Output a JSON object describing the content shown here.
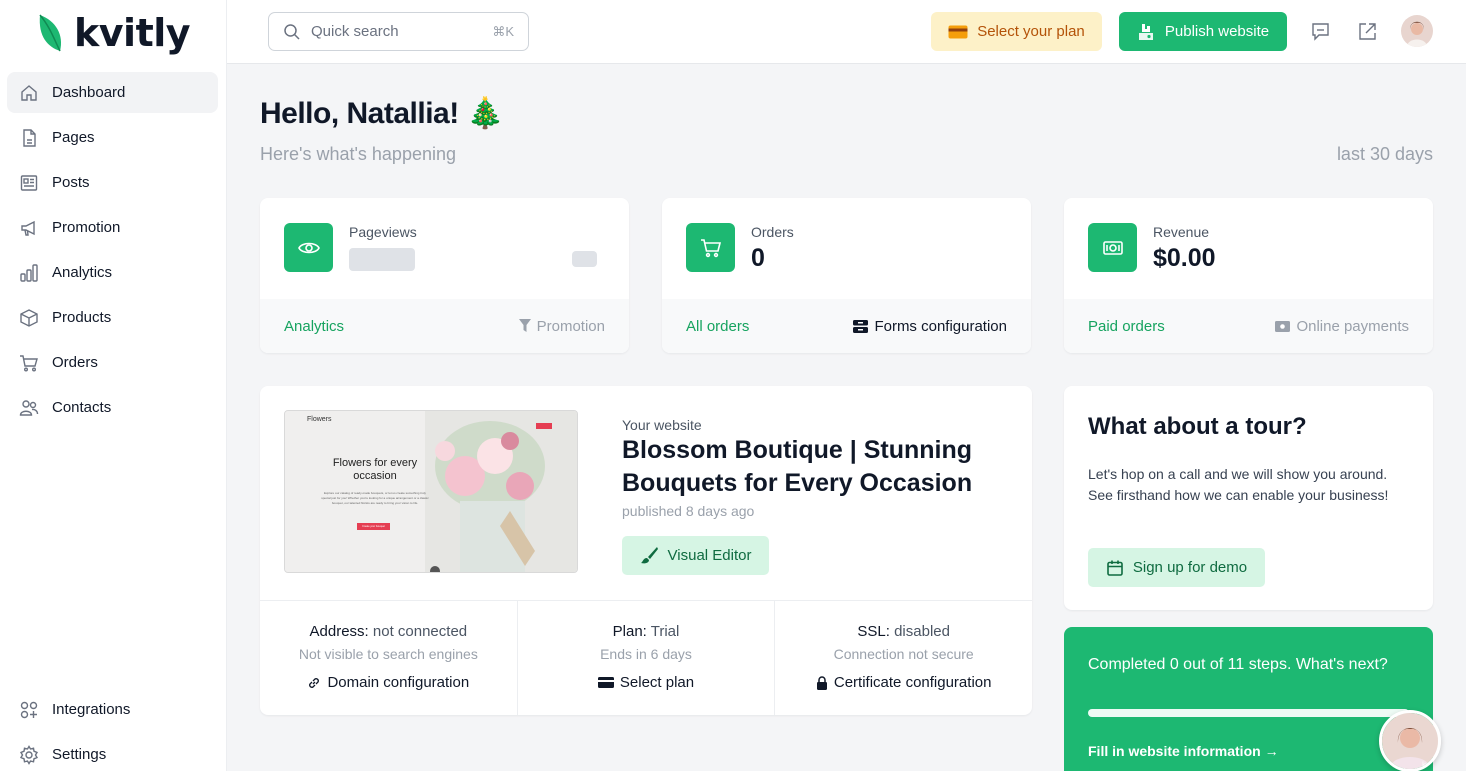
{
  "brand": {
    "name": "kvitly"
  },
  "sidebar": {
    "items": [
      {
        "label": "Dashboard",
        "icon": "home-icon",
        "active": true
      },
      {
        "label": "Pages",
        "icon": "page-icon"
      },
      {
        "label": "Posts",
        "icon": "posts-icon"
      },
      {
        "label": "Promotion",
        "icon": "megaphone-icon"
      },
      {
        "label": "Analytics",
        "icon": "bar-chart-icon"
      },
      {
        "label": "Products",
        "icon": "box-icon"
      },
      {
        "label": "Orders",
        "icon": "cart-icon"
      },
      {
        "label": "Contacts",
        "icon": "users-icon"
      }
    ],
    "bottom_items": [
      {
        "label": "Integrations",
        "icon": "integrations-icon"
      },
      {
        "label": "Settings",
        "icon": "gear-icon"
      }
    ]
  },
  "topbar": {
    "search_placeholder": "Quick search",
    "search_shortcut": "⌘K",
    "select_plan_label": "Select your plan",
    "publish_label": "Publish website"
  },
  "main": {
    "greeting": "Hello, Natallia! 🎄",
    "subtitle": "Here's what's happening",
    "period": "last 30 days"
  },
  "stats": [
    {
      "label": "Pageviews",
      "value": "",
      "link": "Analytics",
      "secondary": "Promotion"
    },
    {
      "label": "Orders",
      "value": "0",
      "link": "All orders",
      "secondary": "Forms configuration"
    },
    {
      "label": "Revenue",
      "value": "$0.00",
      "link": "Paid orders",
      "secondary": "Online payments"
    }
  ],
  "website": {
    "eyebrow": "Your website",
    "title": "Blossom Boutique | Stunning Bouquets for Every Occasion",
    "published": "published 8 days ago",
    "editor_label": "Visual Editor",
    "preview": {
      "brand": "Flowers",
      "headline": "Flowers for every occasion",
      "body": "Explore our catalog of ready-made bouquets, or let us create something truly special just for you! Whether you're looking for a unique arrangement or a classic bouquet, our talented florists are ready to bring your vision to life.",
      "cta": "Create your bouquet"
    },
    "info": [
      {
        "head_key": "Address:",
        "head_value": "not connected",
        "sub": "Not visible to search engines",
        "link": "Domain configuration"
      },
      {
        "head_key": "Plan:",
        "head_value": "Trial",
        "sub": "Ends in 6 days",
        "link": "Select plan"
      },
      {
        "head_key": "SSL:",
        "head_value": "disabled",
        "sub": "Connection not secure",
        "link": "Certificate configuration"
      }
    ]
  },
  "tour": {
    "title": "What about a tour?",
    "text": "Let's hop on a call and we will show you around. See firsthand how we can enable your business!",
    "button": "Sign up for demo"
  },
  "steps": {
    "text": "Completed 0 out of 11 steps. What's next?",
    "completed": 0,
    "total": 11,
    "link": "Fill in website information →"
  },
  "colors": {
    "accent": "#1db872",
    "accent_soft": "#d6f5e4",
    "plan_bg": "#fdf1c8",
    "plan_text": "#b45309"
  }
}
